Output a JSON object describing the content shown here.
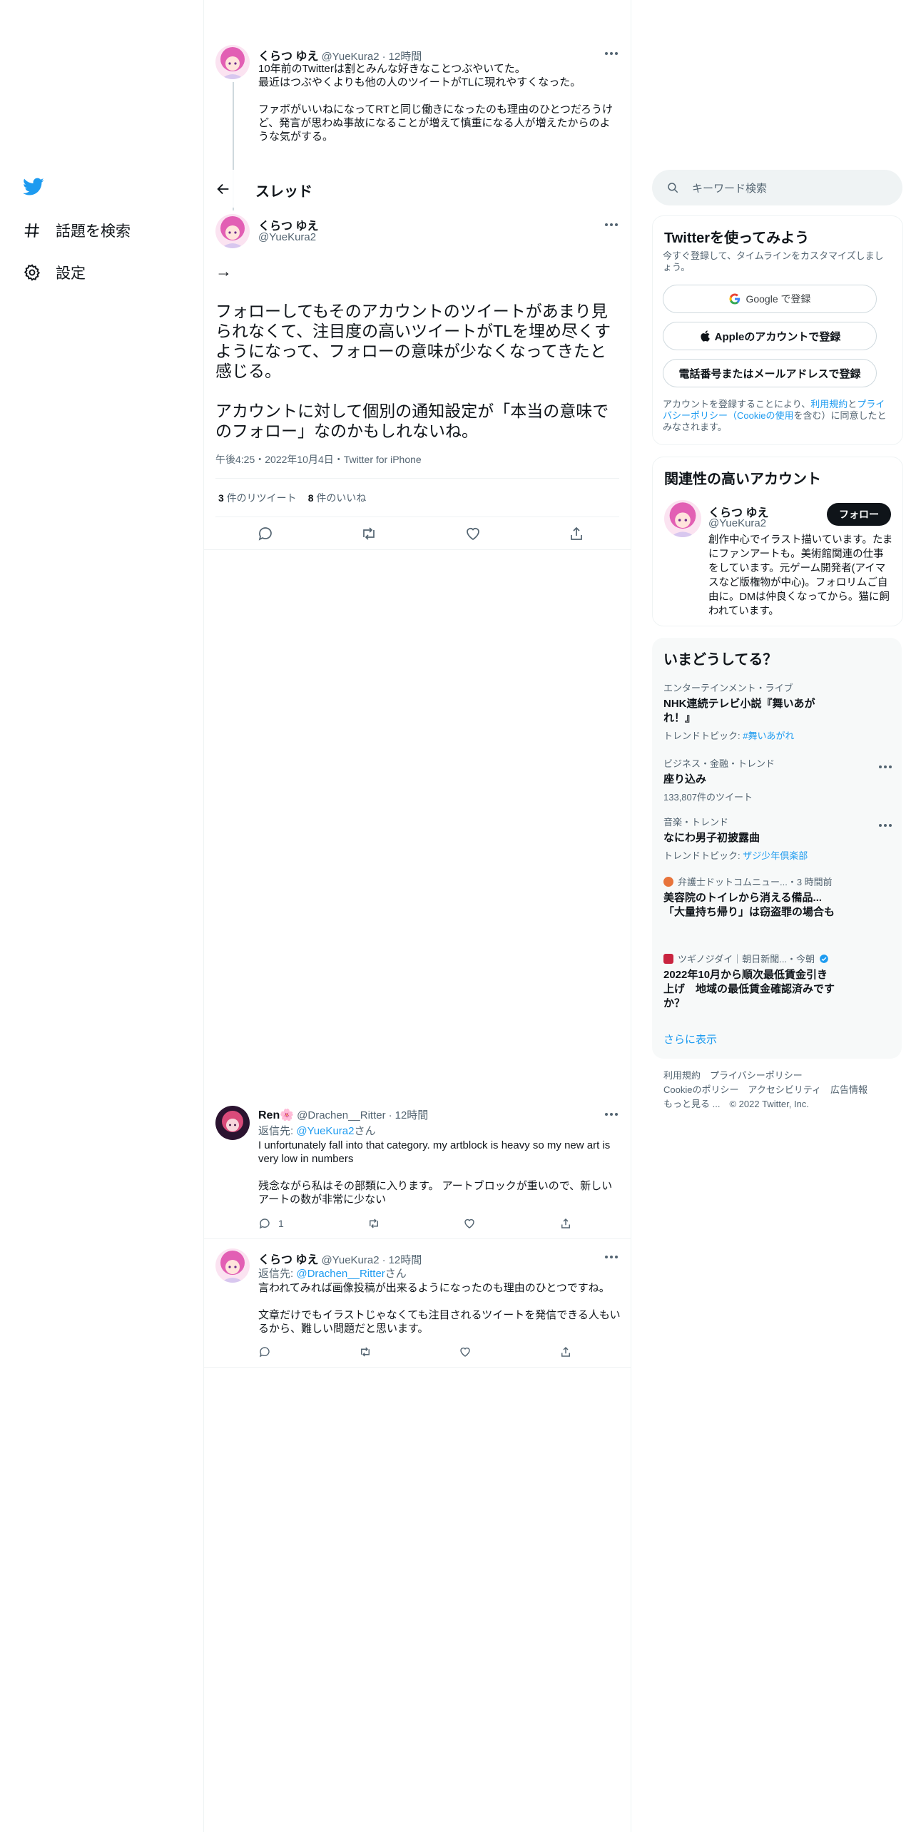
{
  "nav": {
    "explore_label": "話題を検索",
    "settings_label": "設定"
  },
  "prev_tweet": {
    "name": "くらつ ゆえ",
    "handle": "@YueKura2",
    "time": "12時間",
    "line1": "10年前のTwitterは割とみんな好きなことつぶやいてた。",
    "line2": "最近はつぶやくよりも他の人のツイートがTLに現れやすくなった。",
    "para2": "ファボがいいねになってRTと同じ働きになったのも理由のひとつだろうけど、発言が思わぬ事故になることが増えて慎重になる人が増えたからのような気がする。"
  },
  "thread": {
    "header_title": "スレッド",
    "name": "くらつ ゆえ",
    "handle": "@YueKura2",
    "arrow_line": "→",
    "para1": "フォローしてもそのアカウントのツイートがあまり見られなくて、注目度の高いツイートがTLを埋め尽くすようになって、フォローの意味が少なくなってきたと感じる。",
    "para2": "アカウントに対して個別の通知設定が「本当の意味でのフォロー」なのかもしれないね。",
    "timestamp": "午後4:25・2022年10月4日・Twitter for iPhone",
    "retweet_count": "3",
    "retweet_label": "件のリツイート",
    "like_count": "8",
    "like_label": "件のいいね"
  },
  "replies": [
    {
      "name": "Ren🌸",
      "handle": "@Drachen__Ritter",
      "time": "12時間",
      "reply_prefix": "返信先: ",
      "reply_to": "@YueKura2",
      "reply_suffix": "さん",
      "para1": "I unfortunately fall into that category. my artblock is heavy so my new art is very low in numbers",
      "para2": "残念ながら私はその部類に入ります。 アートブロックが重いので、新しいアートの数が非常に少ない",
      "reply_count": "1"
    },
    {
      "name": "くらつ ゆえ",
      "handle": "@YueKura2",
      "time": "12時間",
      "reply_prefix": "返信先: ",
      "reply_to": "@Drachen__Ritter",
      "reply_suffix": "さん",
      "para1": "言われてみれば画像投稿が出来るようになったのも理由のひとつですね。",
      "para2": "文章だけでもイラストじゃなくても注目されるツイートを発信できる人もいるから、難しい問題だと思います。",
      "reply_count": ""
    }
  ],
  "sidebar": {
    "search_placeholder": "キーワード検索",
    "signup": {
      "title": "Twitterを使ってみよう",
      "desc": "今すぐ登録して、タイムラインをカスタマイズしましょう。",
      "google_btn": "Google で登録",
      "apple_btn": "Appleのアカウントで登録",
      "phone_btn": "電話番号またはメールアドレスで登録",
      "terms_prefix": "アカウントを登録することにより、",
      "terms_link1": "利用規約",
      "terms_mid": "と",
      "terms_link2": "プライバシーポリシー（Cookieの使用",
      "terms_suffix": "を含む）に同意したとみなされます。"
    },
    "related": {
      "title": "関連性の高いアカウント",
      "name": "くらつ ゆえ",
      "handle": "@YueKura2",
      "follow_btn": "フォロー",
      "bio": "創作中心でイラスト描いています。たまにファンアートも。美術館関連の仕事をしています。元ゲーム開発者(アイマスなど版権物が中心)。フォロリムご自由に。DMは仲良くなってから。猫に飼われています。"
    },
    "trends": {
      "title": "いまどうしてる？",
      "items": [
        {
          "category": "エンターテインメント・ライブ",
          "title": "NHK連続テレビ小説『舞いあがれ！』",
          "sub_prefix": "トレンドトピック: ",
          "sub_link": "#舞いあがれ"
        },
        {
          "category": "ビジネス・金融・トレンド",
          "title": "座り込み",
          "sub_prefix": "133,807件のツイート",
          "sub_link": ""
        },
        {
          "category": "音楽・トレンド",
          "title": "なにわ男子初披露曲",
          "sub_prefix": "トレンドトピック: ",
          "sub_link": "ザジ少年倶楽部"
        },
        {
          "category": "弁護士ドットコムニュー...・3 時間前",
          "title": "美容院のトイレから消える備品...「大量持ち帰り」は窃盗罪の場合も",
          "sub_prefix": "",
          "sub_link": ""
        },
        {
          "category": "ツギノジダイ｜朝日新聞...・今朝",
          "title": "2022年10月から順次最低賃金引き上げ　地域の最低賃金確認済みですか？",
          "sub_prefix": "",
          "sub_link": ""
        }
      ],
      "show_more": "さらに表示"
    },
    "footer": {
      "line1": "利用規約　プライバシーポリシー",
      "line2": "Cookieのポリシー　アクセシビリティ　広告情報",
      "line3": "もっと見る ...　© 2022 Twitter, Inc."
    }
  },
  "colors": {
    "brand": "#1d9bf0",
    "text": "#0f1419",
    "muted": "#536471",
    "border": "#eff3f4"
  }
}
